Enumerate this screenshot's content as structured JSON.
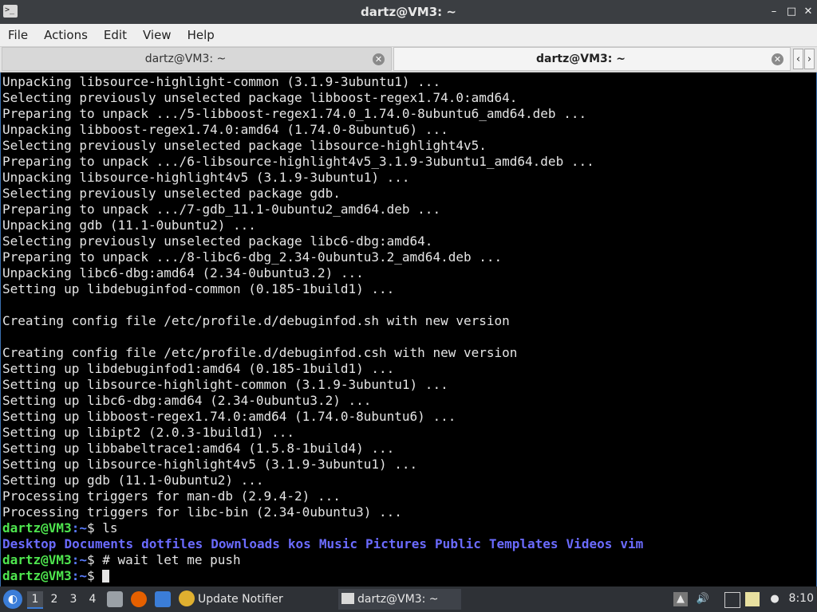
{
  "window": {
    "title": "dartz@VM3: ~",
    "icon_text": ">_",
    "minimize_glyph": "–",
    "maximize_glyph": "□",
    "close_glyph": "✕"
  },
  "menu": [
    "File",
    "Actions",
    "Edit",
    "View",
    "Help"
  ],
  "tabs": [
    {
      "label": "dartz@VM3: ~",
      "active": false
    },
    {
      "label": "dartz@VM3: ~",
      "active": true
    }
  ],
  "tab_close_glyph": "✕",
  "tab_scroll": {
    "left": "‹",
    "right": "›"
  },
  "terminal": {
    "lines": [
      "Unpacking libsource-highlight-common (3.1.9-3ubuntu1) ...",
      "Selecting previously unselected package libboost-regex1.74.0:amd64.",
      "Preparing to unpack .../5-libboost-regex1.74.0_1.74.0-8ubuntu6_amd64.deb ...",
      "Unpacking libboost-regex1.74.0:amd64 (1.74.0-8ubuntu6) ...",
      "Selecting previously unselected package libsource-highlight4v5.",
      "Preparing to unpack .../6-libsource-highlight4v5_3.1.9-3ubuntu1_amd64.deb ...",
      "Unpacking libsource-highlight4v5 (3.1.9-3ubuntu1) ...",
      "Selecting previously unselected package gdb.",
      "Preparing to unpack .../7-gdb_11.1-0ubuntu2_amd64.deb ...",
      "Unpacking gdb (11.1-0ubuntu2) ...",
      "Selecting previously unselected package libc6-dbg:amd64.",
      "Preparing to unpack .../8-libc6-dbg_2.34-0ubuntu3.2_amd64.deb ...",
      "Unpacking libc6-dbg:amd64 (2.34-0ubuntu3.2) ...",
      "Setting up libdebuginfod-common (0.185-1build1) ...",
      "",
      "Creating config file /etc/profile.d/debuginfod.sh with new version",
      "",
      "Creating config file /etc/profile.d/debuginfod.csh with new version",
      "Setting up libdebuginfod1:amd64 (0.185-1build1) ...",
      "Setting up libsource-highlight-common (3.1.9-3ubuntu1) ...",
      "Setting up libc6-dbg:amd64 (2.34-0ubuntu3.2) ...",
      "Setting up libboost-regex1.74.0:amd64 (1.74.0-8ubuntu6) ...",
      "Setting up libipt2 (2.0.3-1build1) ...",
      "Setting up libbabeltrace1:amd64 (1.5.8-1build4) ...",
      "Setting up libsource-highlight4v5 (3.1.9-3ubuntu1) ...",
      "Setting up gdb (11.1-0ubuntu2) ...",
      "Processing triggers for man-db (2.9.4-2) ...",
      "Processing triggers for libc-bin (2.34-0ubuntu3) ..."
    ],
    "prompt_user": "dartz@VM3",
    "prompt_path": ":~",
    "prompt_symbol": "$ ",
    "commands": [
      "ls",
      "# wait let me push",
      ""
    ],
    "ls_output": [
      "Desktop",
      "Documents",
      "dotfiles",
      "Downloads",
      "kos",
      "Music",
      "Pictures",
      "Public",
      "Templates",
      "Videos",
      "vim"
    ]
  },
  "taskbar": {
    "workspaces": [
      "1",
      "2",
      "3",
      "4"
    ],
    "active_workspace": "1",
    "tasks": [
      {
        "label": "Update Notifier",
        "icon": "update-notifier-icon"
      },
      {
        "label": "dartz@VM3: ~",
        "icon": "terminal-icon"
      }
    ],
    "clock": "8:10",
    "accent": "#3b7dd8"
  },
  "colors": {
    "terminal_bg": "#000000",
    "terminal_fg": "#e5e5e5",
    "prompt_user": "#4ee54e",
    "prompt_path": "#5a7cff",
    "directory": "#6b6bff"
  }
}
